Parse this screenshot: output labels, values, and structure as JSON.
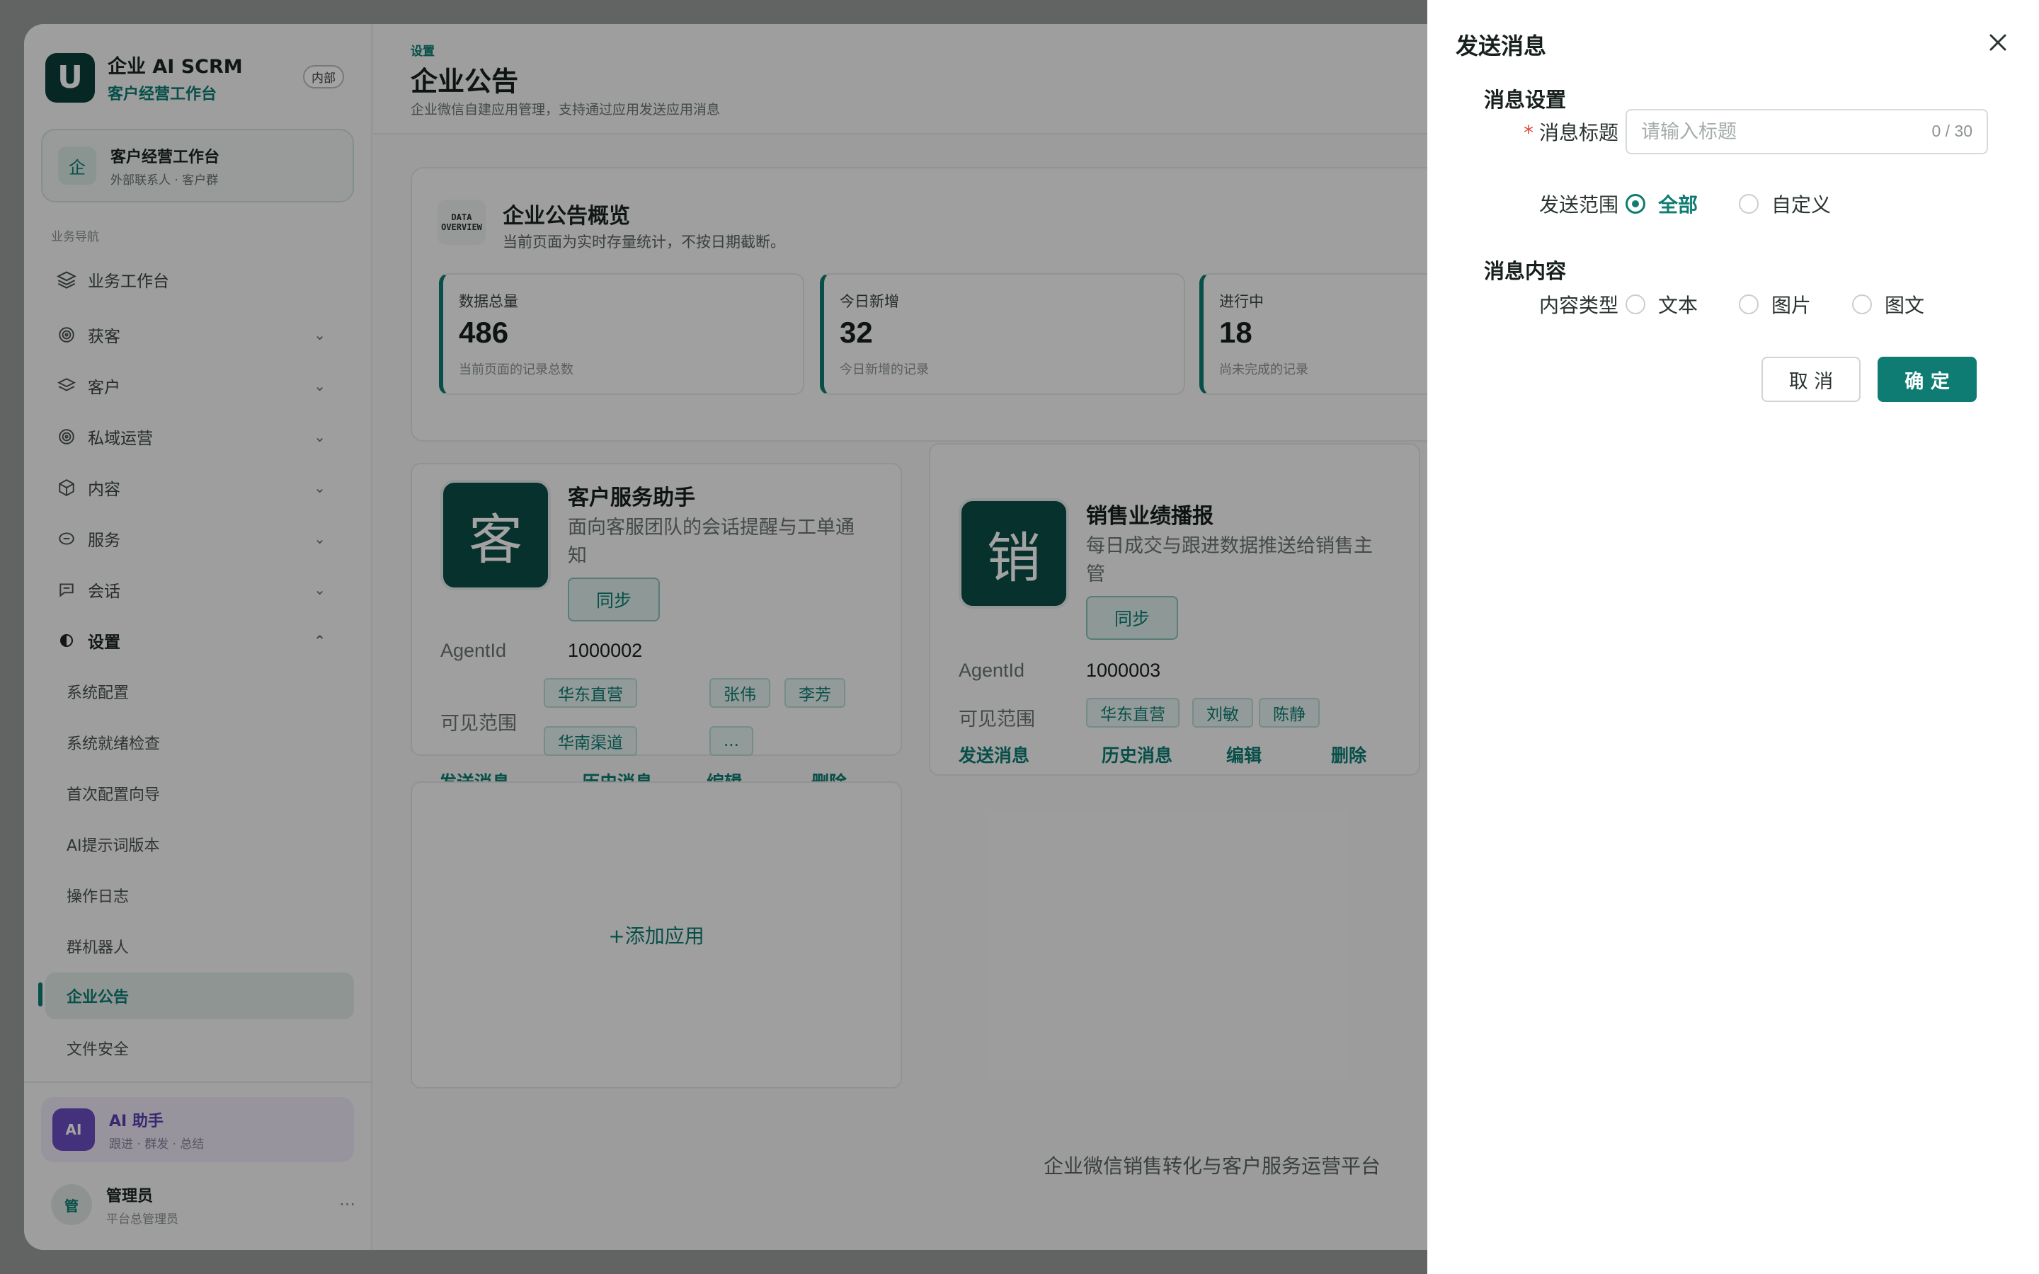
{
  "brand": {
    "logo": "U",
    "title": "企业 AI SCRM",
    "subtitle": "客户经营工作台",
    "badge": "内部"
  },
  "workspace": {
    "icon": "企",
    "title": "客户经营工作台",
    "subtitle": "外部联系人 · 客户群"
  },
  "nav": {
    "caption": "业务导航",
    "top_item": {
      "label": "业务工作台",
      "icon": "layers-icon"
    },
    "groups": [
      {
        "label": "获客",
        "icon": "target-icon"
      },
      {
        "label": "客户",
        "icon": "layers-icon"
      },
      {
        "label": "私域运营",
        "icon": "target-icon"
      },
      {
        "label": "内容",
        "icon": "box-icon"
      },
      {
        "label": "服务",
        "icon": "service-icon"
      },
      {
        "label": "会话",
        "icon": "chat-icon"
      },
      {
        "label": "设置",
        "icon": "settings-icon"
      }
    ],
    "settings_children": [
      "系统配置",
      "系统就绪检查",
      "首次配置向导",
      "AI提示词版本",
      "操作日志",
      "群机器人",
      "企业公告",
      "文件安全"
    ],
    "active": "企业公告"
  },
  "ai_card": {
    "icon": "AI",
    "title": "AI 助手",
    "subtitle": "跟进 · 群发 · 总结"
  },
  "user": {
    "avatar": "管",
    "name": "管理员",
    "role": "平台总管理员",
    "more": "···"
  },
  "header": {
    "crumb": "设置",
    "title": "企业公告",
    "desc": "企业微信自建应用管理，支持通过应用发送应用消息"
  },
  "overview": {
    "icon_text": "DATA OVERVIEW",
    "title": "企业公告概览",
    "desc": "当前页面为实时存量统计，不按日期截断。",
    "stats": [
      {
        "label": "数据总量",
        "value": "486",
        "note": "当前页面的记录总数"
      },
      {
        "label": "今日新增",
        "value": "32",
        "note": "今日新增的记录"
      },
      {
        "label": "进行中",
        "value": "18",
        "note": "尚未完成的记录"
      }
    ]
  },
  "apps": [
    {
      "avatar": "客",
      "name": "客户服务助手",
      "desc": "面向客服团队的会话提醒与工单通知",
      "sync": "同步",
      "agent_label": "AgentId",
      "agent_id": "1000002",
      "scope_label": "可见范围",
      "tags": [
        "华东直营",
        "张伟",
        "李芳",
        "华南渠道",
        "..."
      ]
    },
    {
      "avatar": "销",
      "name": "销售业绩播报",
      "desc": "每日成交与跟进数据推送给销售主管",
      "sync": "同步",
      "agent_label": "AgentId",
      "agent_id": "1000003",
      "scope_label": "可见范围",
      "tags": [
        "华东直营",
        "刘敏",
        "陈静"
      ]
    }
  ],
  "app_actions": [
    "发送消息",
    "历史消息",
    "编辑",
    "删除"
  ],
  "add_app": "+添加应用",
  "footer": "企业微信销售转化与客户服务运营平台",
  "drawer": {
    "title": "发送消息",
    "close_icon": "close-icon",
    "section_settings": "消息设置",
    "title_label": "消息标题",
    "title_required": "*",
    "title_placeholder": "请输入标题",
    "title_value": "",
    "title_counter": "0 / 30",
    "scope_label": "发送范围",
    "scope_options": [
      "全部",
      "自定义"
    ],
    "scope_selected": "全部",
    "section_content": "消息内容",
    "type_label": "内容类型",
    "type_options": [
      "文本",
      "图片",
      "图文"
    ],
    "cancel": "取 消",
    "confirm": "确 定"
  },
  "colors": {
    "accent": "#0e7c72",
    "dark_brand": "#0b4e45",
    "required": "#e04a3a",
    "ai_purple": "#6b4ec2"
  }
}
